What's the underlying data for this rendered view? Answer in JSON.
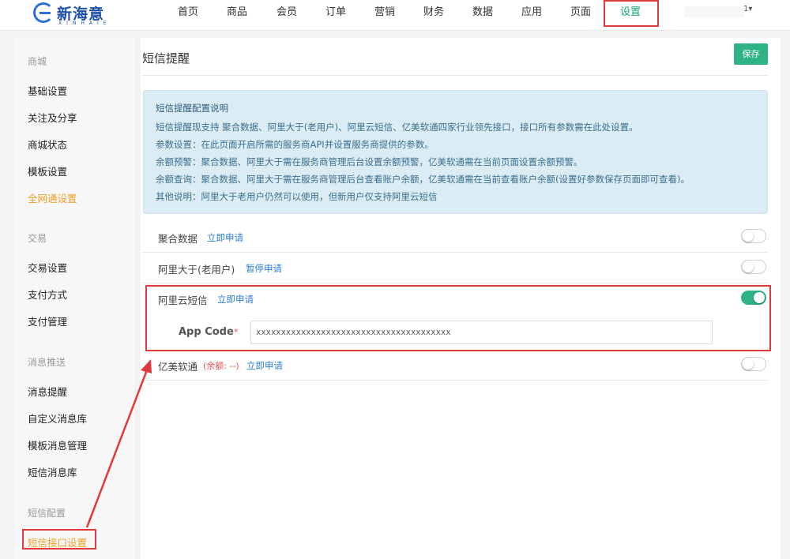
{
  "brand": {
    "name": "新海意",
    "sub": "XINHAIE"
  },
  "nav": [
    {
      "label": "首页"
    },
    {
      "label": "商品"
    },
    {
      "label": "会员"
    },
    {
      "label": "订单"
    },
    {
      "label": "营销"
    },
    {
      "label": "财务"
    },
    {
      "label": "数据"
    },
    {
      "label": "应用"
    },
    {
      "label": "页面"
    },
    {
      "label": "设置",
      "active": true
    }
  ],
  "user": {
    "label": "1"
  },
  "sidebar": {
    "groups": [
      {
        "title": "商城",
        "items": [
          "基础设置",
          "关注及分享",
          "商城状态",
          "模板设置",
          "全网通设置"
        ]
      },
      {
        "title": "交易",
        "items": [
          "交易设置",
          "支付方式",
          "支付管理"
        ]
      },
      {
        "title": "消息推送",
        "items": [
          "消息提醒",
          "自定义消息库",
          "模板消息管理",
          "短信消息库"
        ]
      },
      {
        "title": "短信配置",
        "items": [
          "短信接口设置"
        ]
      }
    ]
  },
  "page": {
    "title": "短信提醒",
    "save": "保存"
  },
  "info": {
    "title": "短信提醒配置说明",
    "lines": [
      "短信提醒现支持 聚合数据、阿里大于(老用户)、阿里云短信、亿美软通四家行业领先接口，接口所有参数需在此处设置。",
      "参数设置：在此页面开启所需的服务商API并设置服务商提供的参数。",
      "余额预警：聚合数据、阿里大于需在服务商管理后台设置余额预警，亿美软通需在当前页面设置余额预警。",
      "余额查询：聚合数据、阿里大于需在服务商管理后台查看账户余额，亿美软通需在当前查看账户余额(设置好参数保存页面即可查看)。",
      "其他说明：阿里大于老用户仍然可以使用，但新用户仅支持阿里云短信"
    ]
  },
  "providers": [
    {
      "name": "聚合数据",
      "link": "立即申请",
      "enabled": false
    },
    {
      "name": "阿里大于(老用户)",
      "link": "暂停申请",
      "enabled": false
    },
    {
      "name": "阿里云短信",
      "link": "立即申请",
      "enabled": true
    },
    {
      "name": "亿美软通",
      "balance": "(余额: --)",
      "link": "立即申请",
      "enabled": false
    }
  ],
  "appcode": {
    "label": "App Code",
    "required": "*",
    "value": "xxxxxxxxxxxxxxxxxxxxxxxxxxxxxxxxxxxxxxx"
  },
  "colors": {
    "accent": "#2fb287",
    "highlight": "#e03a3a",
    "sidebar_active": "#f0a12a",
    "link": "#2f7fd3"
  }
}
